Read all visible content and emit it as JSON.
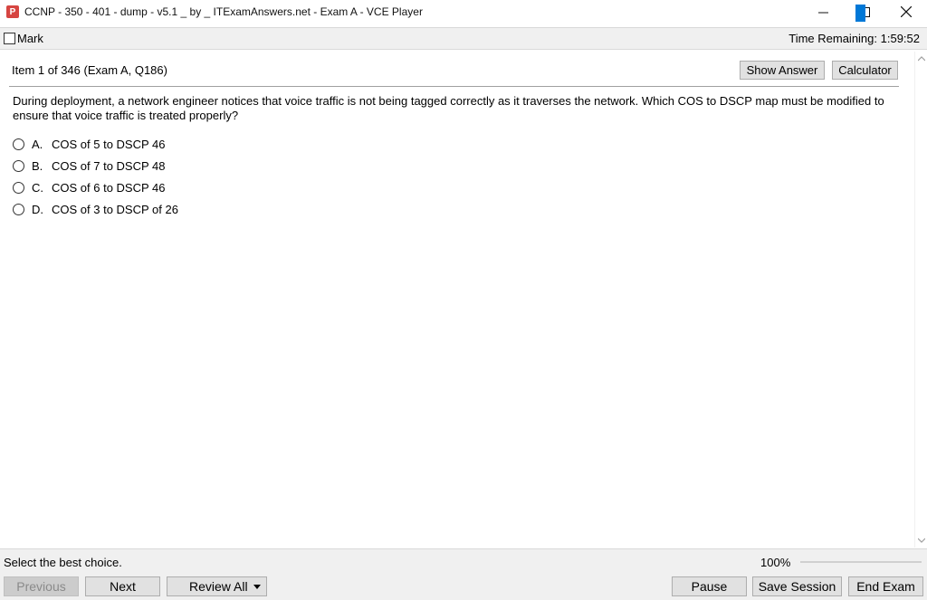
{
  "window": {
    "app_icon_letter": "P",
    "title": "CCNP - 350 - 401 - dump - v5.1 _ by _ ITExamAnswers.net - Exam A - VCE Player"
  },
  "toolbar": {
    "mark_label": "Mark",
    "time_remaining": "Time Remaining: 1:59:52"
  },
  "item": {
    "info": "Item 1 of 346  (Exam A, Q186)",
    "show_answer_label": "Show Answer",
    "calculator_label": "Calculator"
  },
  "question": {
    "text": "During deployment, a network engineer notices that voice traffic is not being tagged correctly as it traverses the network. Which COS to DSCP map must be modified to ensure that voice traffic is treated properly?",
    "options": [
      {
        "letter": "A.",
        "text": "COS of 5 to DSCP 46"
      },
      {
        "letter": "B.",
        "text": "COS of 7 to DSCP 48"
      },
      {
        "letter": "C.",
        "text": "COS of 6 to DSCP 46"
      },
      {
        "letter": "D.",
        "text": "COS of 3 to DSCP of 26"
      }
    ]
  },
  "status": {
    "hint": "Select the best choice.",
    "zoom": "100%"
  },
  "bottom": {
    "previous_label": "Previous",
    "next_label": "Next",
    "review_all_label": "Review All",
    "pause_label": "Pause",
    "save_session_label": "Save Session",
    "end_exam_label": "End Exam"
  },
  "colors": {
    "accent": "#0078d7",
    "app_icon": "#d64541"
  }
}
